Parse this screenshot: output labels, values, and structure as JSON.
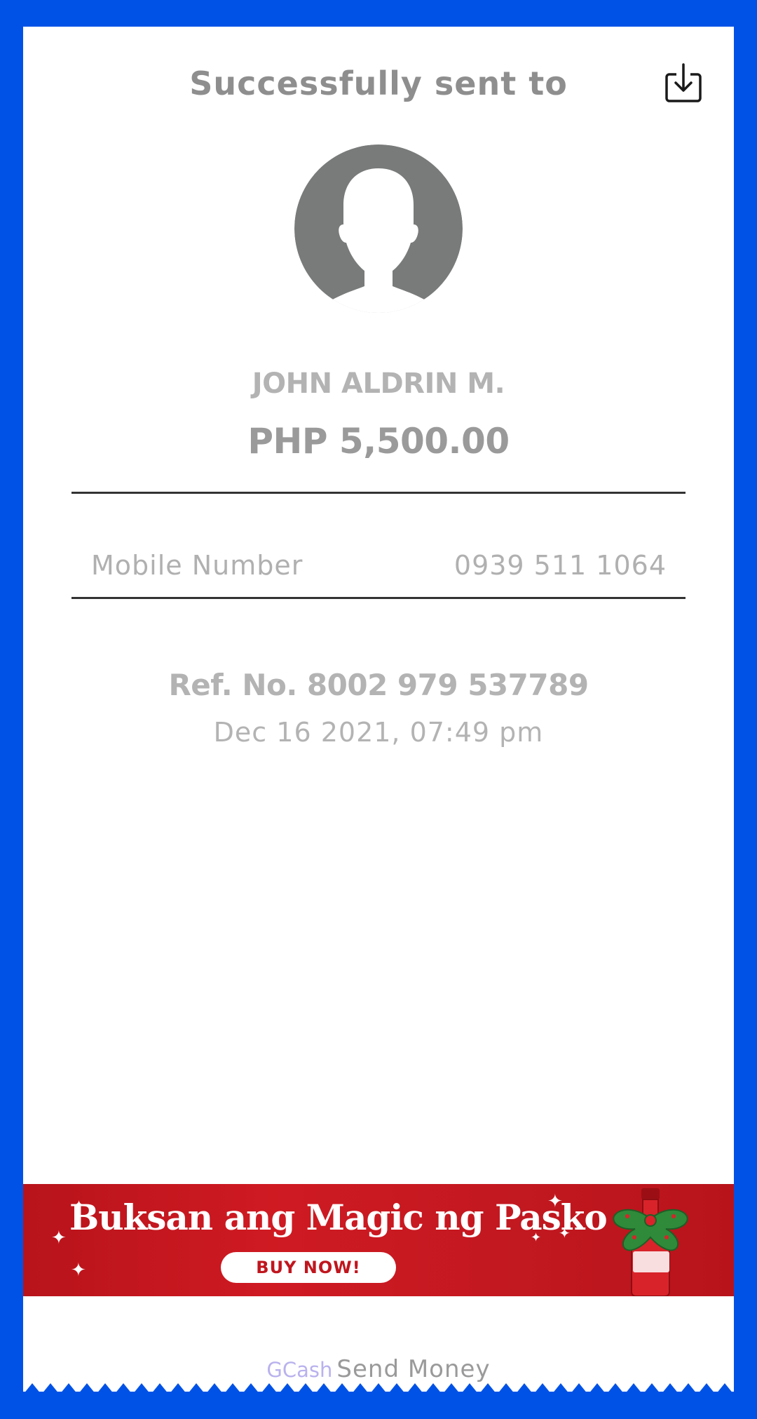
{
  "receipt": {
    "header_title": "Successfully sent to",
    "recipient_name": "JOHN ALDRIN M.",
    "amount": "PHP 5,500.00",
    "details": {
      "label": "Mobile Number",
      "value": "0939 511 1064"
    },
    "reference": "Ref. No. 8002 979 537789",
    "datetime": "Dec 16 2021, 07:49 pm"
  },
  "banner": {
    "headline": "Buksan ang Magic ng Pasko",
    "cta": "BUY NOW!"
  },
  "footer": {
    "brand": "GCash",
    "text": "Send Money"
  },
  "icons": {
    "download": "download-icon",
    "avatar": "default-avatar-icon"
  },
  "colors": {
    "background": "#0052e6",
    "receipt": "#ffffff",
    "banner": "#c8161e",
    "brand_text": "#b9b2ee"
  }
}
